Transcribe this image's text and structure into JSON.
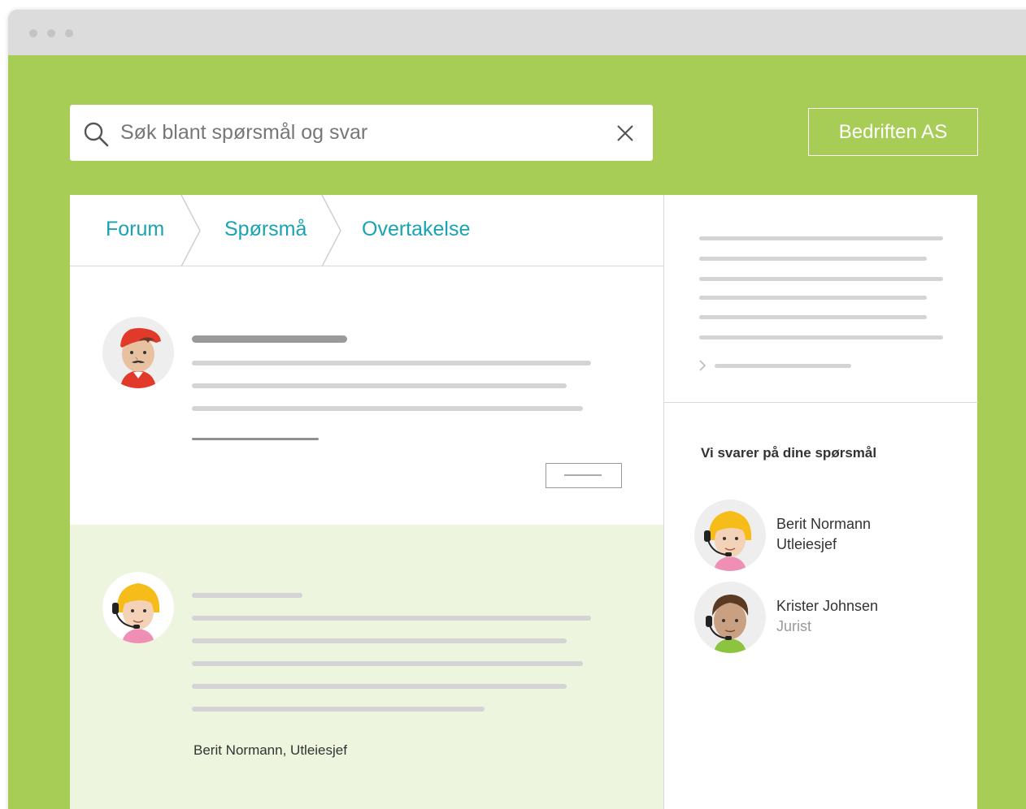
{
  "search": {
    "placeholder": "Søk blant spørsmål og svar"
  },
  "header": {
    "company_label": "Bedriften AS"
  },
  "breadcrumb": {
    "items": [
      "Forum",
      "Spørsmå",
      "Overtakelse"
    ]
  },
  "answer": {
    "signature": "Berit Normann, Utleiesjef"
  },
  "sidebar": {
    "heading": "Vi svarer på dine spørsmål",
    "experts": [
      {
        "name": "Berit Normann",
        "role": "Utleiesjef",
        "role_color": "#333333"
      },
      {
        "name": "Krister Johnsen",
        "role": "Jurist",
        "role_color": "#999999"
      }
    ]
  },
  "colors": {
    "background": "#a8cd57",
    "link": "#1aa3b3",
    "answer_bg": "#edf5df"
  }
}
